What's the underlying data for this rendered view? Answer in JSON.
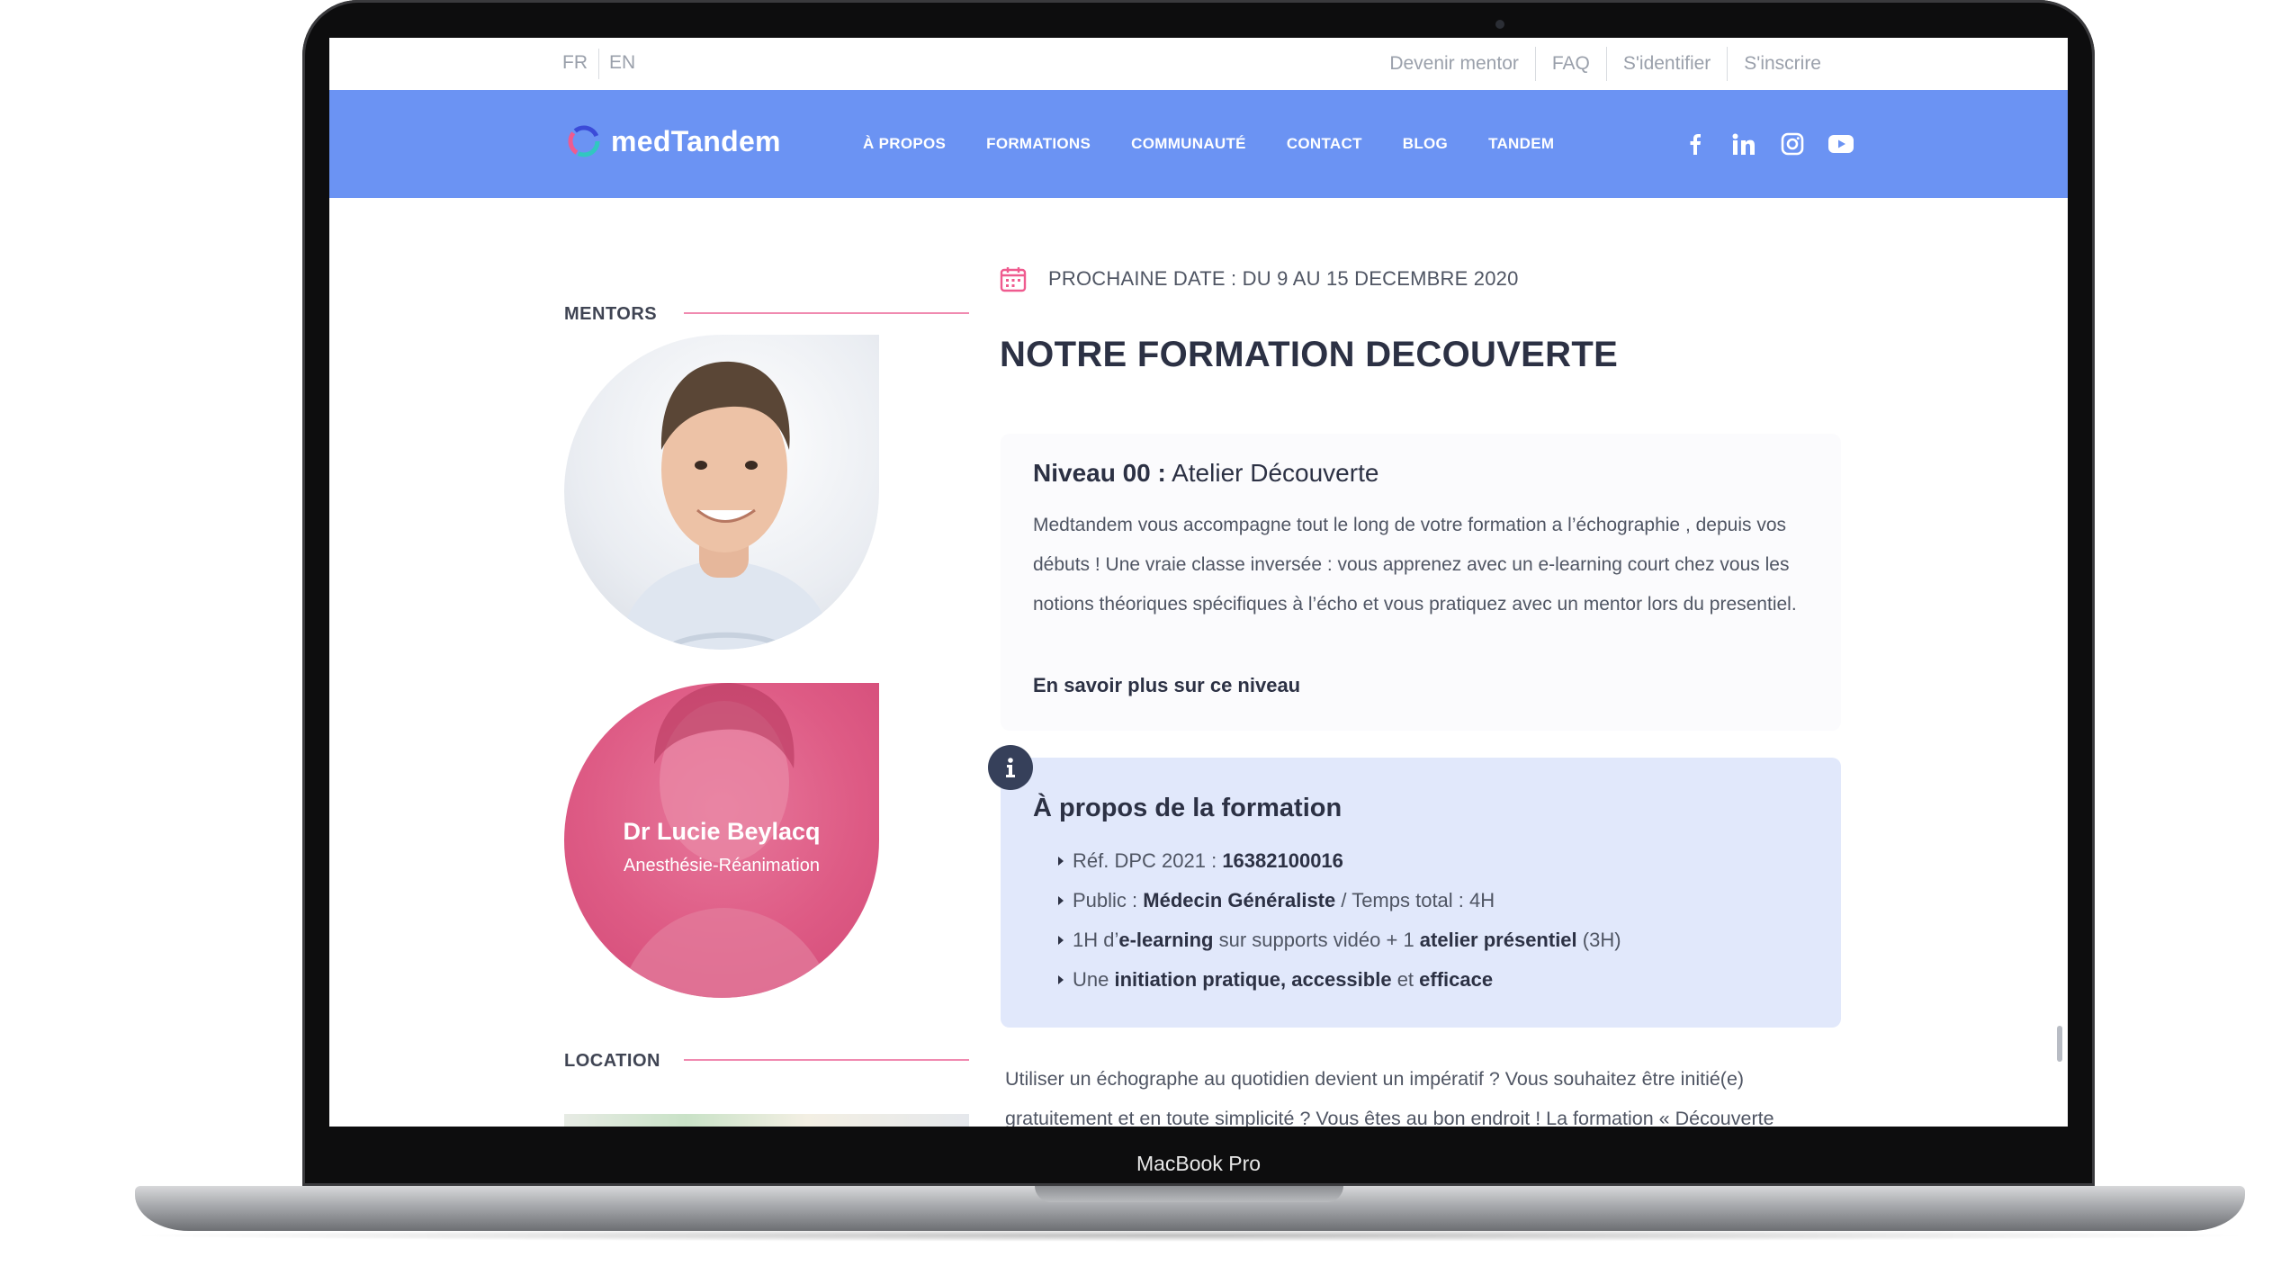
{
  "device": {
    "model_label": "MacBook Pro"
  },
  "utility_bar": {
    "lang_fr": "FR",
    "lang_en": "EN",
    "links": [
      "Devenir mentor",
      "FAQ",
      "S'identifier",
      "S'inscrire"
    ]
  },
  "header": {
    "brand": "medTandem",
    "nav": [
      "À PROPOS",
      "FORMATIONS",
      "COMMUNAUTÉ",
      "CONTACT",
      "BLOG",
      "TANDEM"
    ],
    "social_icons": [
      "facebook-icon",
      "linkedin-icon",
      "instagram-icon",
      "youtube-icon"
    ],
    "bar_color": "#6b93f3"
  },
  "sidebar": {
    "mentors_heading": "MENTORS",
    "mentor_2": {
      "name": "Dr Lucie Beylacq",
      "specialty": "Anesthésie-Réanimation"
    },
    "location_heading": "LOCATION",
    "accent_color": "#f08ab0"
  },
  "main": {
    "next_date": "PROCHAINE DATE : DU 9 AU 15 DECEMBRE 2020",
    "title": "NOTRE FORMATION DECOUVERTE",
    "level": {
      "label_bold": "Niveau 00 :",
      "label_rest": "Atelier Découverte",
      "body": "Medtandem vous accompagne tout le long de votre formation a l’échographie , depuis vos débuts ! Une vraie classe inversée : vous apprenez avec un e-learning court chez vous les notions théoriques spécifiques à l’écho et vous pratiquez avec un mentor lors du presentiel.",
      "link": "En savoir plus sur ce niveau"
    },
    "about": {
      "title": "À propos de la formation",
      "items": [
        {
          "a": "Réf. DPC 2021 : ",
          "b": "16382100016",
          "c": "",
          "d": "",
          "e": "",
          "f": "",
          "g": ""
        },
        {
          "a": "Public : ",
          "b": "Médecin Généraliste",
          "c": " / Temps total : 4H",
          "d": "",
          "e": "",
          "f": "",
          "g": ""
        },
        {
          "a": "1H d’",
          "b": "e-learning",
          "c": " sur supports vidéo + 1 ",
          "d": "atelier présentiel",
          "e": " (3H)",
          "f": "",
          "g": ""
        },
        {
          "a": "Une ",
          "b": "initiation pratique, accessible",
          "c": " et ",
          "d": "efficace",
          "e": "",
          "f": "",
          "g": ""
        }
      ]
    },
    "intro": "Utiliser un échographe au quotidien devient un impératif ? Vous souhaitez être initié(e) gratuitement et en toute simplicité ? Vous êtes au bon endroit ! La formation « Découverte"
  }
}
